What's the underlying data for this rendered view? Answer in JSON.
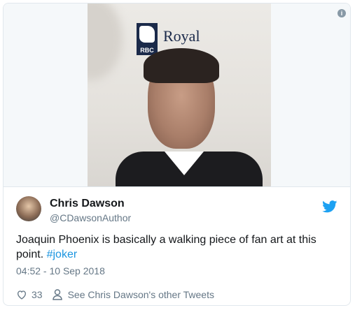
{
  "media": {
    "logo_text": "Royal",
    "logo_sub": "RBC"
  },
  "tweet": {
    "author_name": "Chris Dawson",
    "author_handle": "@CDawsonAuthor",
    "text_main": "Joaquin Phoenix is basically a walking piece of fan art at this point. ",
    "hashtag": "#joker",
    "timestamp": "04:52 - 10 Sep 2018",
    "like_count": "33",
    "other_tweets_link": "See Chris Dawson's other Tweets"
  },
  "colors": {
    "accent": "#1b95e0",
    "secondary_text": "#657786",
    "border": "#e1e8ed"
  },
  "icons": [
    "info-icon",
    "twitter-bird-icon",
    "heart-icon",
    "user-icon"
  ]
}
